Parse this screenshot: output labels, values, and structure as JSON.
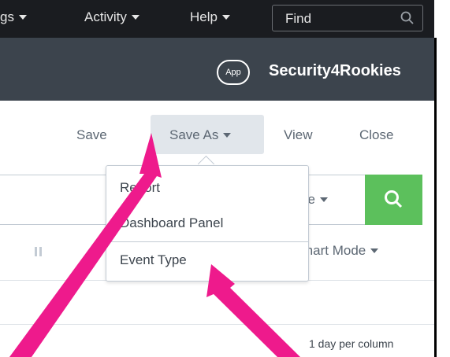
{
  "topbar": {
    "menus": [
      {
        "label": "gs"
      },
      {
        "label": "Activity"
      },
      {
        "label": "Help"
      }
    ],
    "find_placeholder": "Find"
  },
  "appbar": {
    "badge": "App",
    "app_name": "Security4Rookies"
  },
  "toolbar": {
    "save": "Save",
    "save_as": "Save As",
    "view": "View",
    "close": "Close"
  },
  "search": {
    "range_label": "ge",
    "mode_label": "mart Mode"
  },
  "save_as_menu": {
    "items": [
      {
        "label": "Report"
      },
      {
        "label": "Dashboard Panel"
      },
      {
        "label": "Event Type"
      }
    ]
  },
  "timeline": {
    "per_column": "1 day per column"
  },
  "colors": {
    "topbar": "#1a1c20",
    "appbar": "#3c444d",
    "search_button": "#5cc05c",
    "annotation_arrow": "#ee1a8c"
  }
}
